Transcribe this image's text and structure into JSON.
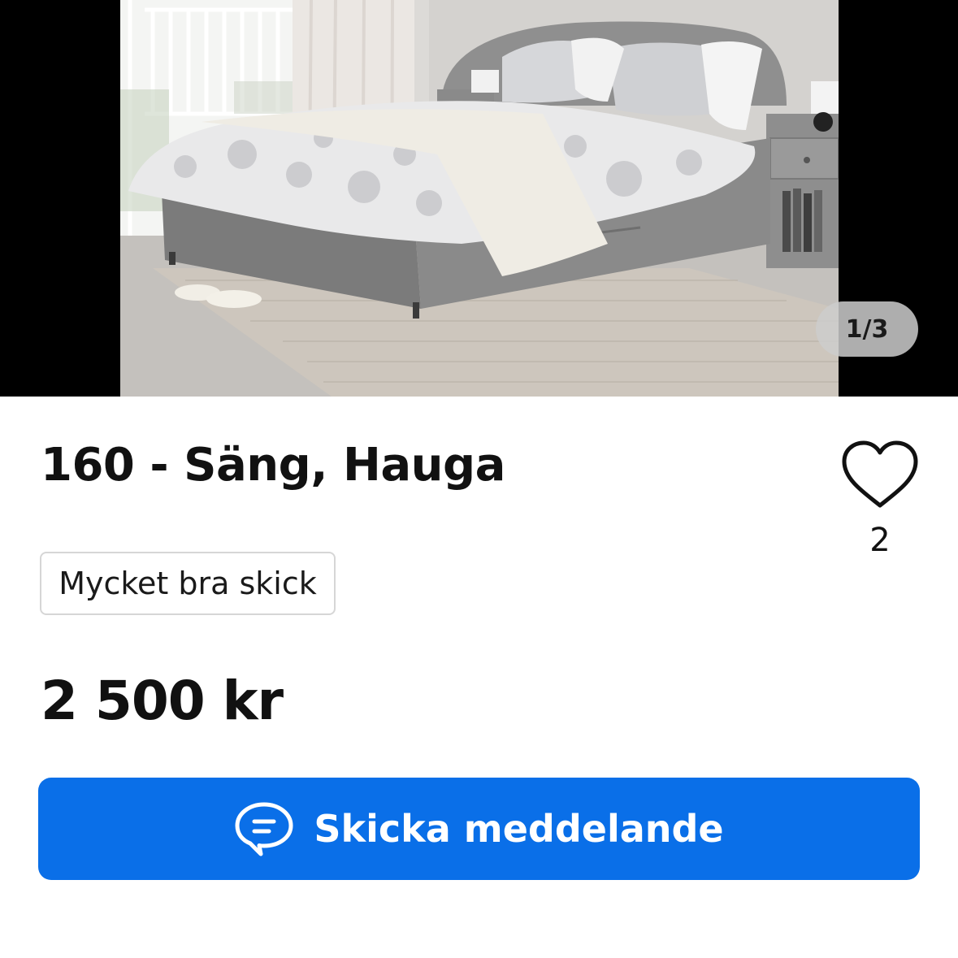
{
  "listing": {
    "image_counter": "1/3",
    "title": "160 - Säng, Hauga",
    "favorite_icon": "heart-outline-icon",
    "favorite_count": "2",
    "condition": "Mycket bra skick",
    "price": "2 500 kr"
  },
  "actions": {
    "message_icon": "chat-bubble-icon",
    "message_label": "Skicka meddelande"
  },
  "colors": {
    "primary_button": "#0a6fe8",
    "text": "#111111",
    "badge_border": "#d6d6d6",
    "gallery_background": "#000000"
  }
}
